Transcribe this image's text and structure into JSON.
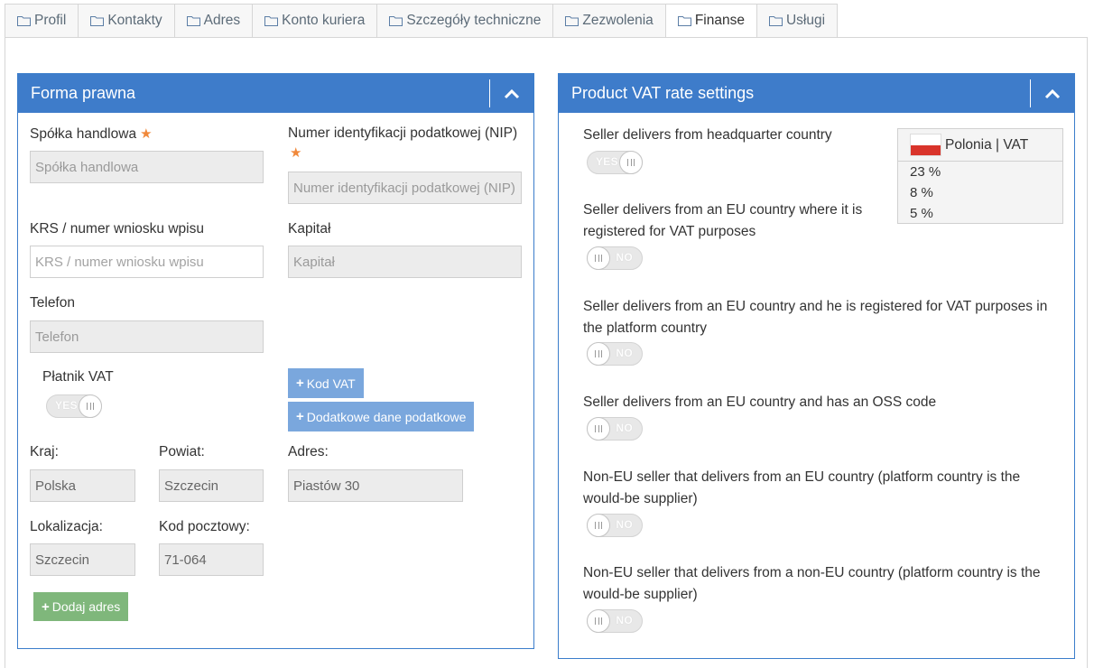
{
  "tabs": [
    {
      "label": "Profil",
      "active": false
    },
    {
      "label": "Kontakty",
      "active": false
    },
    {
      "label": "Adres",
      "active": false
    },
    {
      "label": "Konto kuriera",
      "active": false
    },
    {
      "label": "Szczegóły techniczne",
      "active": false
    },
    {
      "label": "Zezwolenia",
      "active": false
    },
    {
      "label": "Finanse",
      "active": true
    },
    {
      "label": "Usługi",
      "active": false
    }
  ],
  "legal_form": {
    "title": "Forma prawna",
    "company": {
      "label": "Spółka handlowa",
      "required_icon": "★",
      "placeholder": "Spółka handlowa"
    },
    "nip": {
      "label": "Numer identyfikacji podatkowej (NIP)",
      "required_icon": "★",
      "placeholder": "Numer identyfikacji podatkowej (NIP)"
    },
    "krs": {
      "label": "KRS / numer wniosku wpisu",
      "placeholder": "KRS / numer wniosku wpisu"
    },
    "capital": {
      "label": "Kapitał",
      "placeholder": "Kapitał"
    },
    "phone": {
      "label": "Telefon",
      "placeholder": "Telefon"
    },
    "vat_payer": {
      "label": "Płatnik VAT",
      "toggle": "YES"
    },
    "vat_code_button": "Kod VAT",
    "extra_tax_button": "Dodatkowe dane podatkowe",
    "country": {
      "label": "Kraj:",
      "value": "Polska"
    },
    "county": {
      "label": "Powiat:",
      "value": "Szczecin"
    },
    "address": {
      "label": "Adres:",
      "value": "Piastów 30"
    },
    "location": {
      "label": "Lokalizacja:",
      "value": "Szczecin"
    },
    "postal": {
      "label": "Kod pocztowy:",
      "value": "71-064"
    },
    "add_address_button": "Dodaj adres"
  },
  "vat_settings": {
    "title": "Product VAT rate settings",
    "options": [
      {
        "label": "Seller delivers from headquarter country",
        "toggle": "YES"
      },
      {
        "label": "Seller delivers from an EU country where it is registered for VAT purposes",
        "toggle": "NO"
      },
      {
        "label": "Seller delivers from an EU country and he is registered for VAT purposes in the platform country",
        "toggle": "NO"
      },
      {
        "label": "Seller delivers from an EU country and has an OSS code",
        "toggle": "NO"
      },
      {
        "label": "Non-EU seller that delivers from an EU country (platform country is the would-be supplier)",
        "toggle": "NO"
      },
      {
        "label": "Non-EU seller that delivers from a non-EU country (platform country is the would-be supplier)",
        "toggle": "NO"
      }
    ],
    "vat_box": {
      "header": "Polonia | VAT",
      "rates": [
        "23 %",
        "8 %",
        "5 %"
      ]
    }
  },
  "colors": {
    "header_blue": "#3e7cca",
    "button_blue": "#7aa7dd",
    "button_green": "#7fb77b",
    "required_orange": "#f0883a"
  },
  "icons": {
    "tab_icon": "folder-icon",
    "collapse_icon": "chevron-up-icon",
    "plus_icon": "plus-icon",
    "flag_icon": "poland-flag-icon"
  }
}
